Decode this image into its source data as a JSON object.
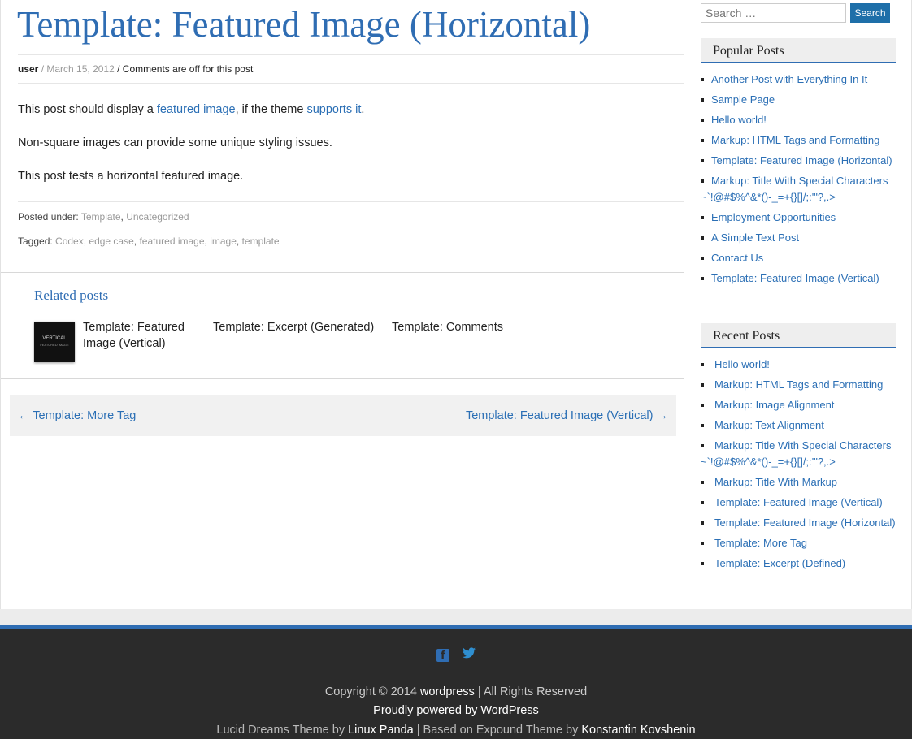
{
  "post": {
    "title": "Template: Featured Image (Horizontal)",
    "author": "user",
    "date": "March 15, 2012",
    "comments_note": "/ Comments are off for this post",
    "para1_before": "This post should display a ",
    "para1_link1": "featured image",
    "para1_mid": ", if the theme ",
    "para1_link2": "supports it",
    "para1_after": ".",
    "para2": "Non-square images can provide some unique styling issues.",
    "para3": "This post tests a horizontal featured image.",
    "posted_under_label": "Posted under:",
    "categories": [
      "Template",
      "Uncategorized"
    ],
    "tagged_label": "Tagged:",
    "tags": [
      "Codex",
      "edge case",
      "featured image",
      "image",
      "template"
    ]
  },
  "related": {
    "heading": "Related posts",
    "thumb_text": "VERTICAL",
    "thumb_subtext": "FEATURED IMAGE",
    "items": [
      "Template: Featured Image (Vertical)",
      "Template: Excerpt (Generated)",
      "Template: Comments"
    ]
  },
  "post_nav": {
    "prev": "← Template: More Tag",
    "next": "Template: Featured Image (Vertical) →"
  },
  "sidebar": {
    "search_placeholder": "Search …",
    "search_button": "Search",
    "popular_title": "Popular Posts",
    "popular": [
      "Another Post with Everything In It",
      "Sample Page",
      "Hello world!",
      "Markup: HTML Tags and Formatting",
      "Template: Featured Image (Horizontal)",
      "Markup: Title With Special Characters ~`!@#$%^&*()-_=+{}[]/;:'\"?,.>",
      "Employment Opportunities",
      "A Simple Text Post",
      "Contact Us",
      "Template: Featured Image (Vertical)"
    ],
    "recent_title": "Recent Posts",
    "recent": [
      "Hello world!",
      "Markup: HTML Tags and Formatting",
      "Markup: Image Alignment",
      "Markup: Text Alignment",
      "Markup: Title With Special Characters ~`!@#$%^&*()-_=+{}[]/;:'\"?,.>",
      "Markup: Title With Markup",
      "Template: Featured Image (Vertical)",
      "Template: Featured Image (Horizontal)",
      "Template: More Tag",
      "Template: Excerpt (Defined)"
    ]
  },
  "footer": {
    "copyright_prefix": "Copyright © 2014 ",
    "site_name": "wordpress",
    "copyright_suffix": " | All Rights Reserved",
    "powered": "Proudly powered by WordPress",
    "theme_prefix": "Lucid Dreams Theme by ",
    "theme_author": "Linux Panda",
    "theme_mid": " | Based on Expound Theme by ",
    "base_author": "Konstantin Kovshenin",
    "facebook_icon": "f",
    "twitter_icon": "🐦"
  },
  "colors": {
    "accent": "#2f6db3",
    "search_button": "#1e6fa9",
    "footer_bg": "#2b2b2b"
  }
}
